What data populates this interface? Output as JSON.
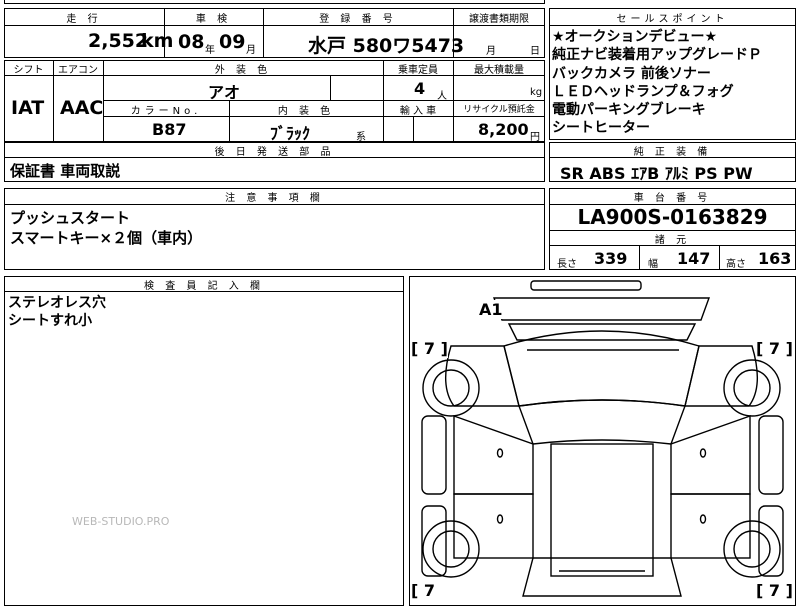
{
  "top_left": {
    "headers": {
      "mileage": "走 行",
      "inspection": "車 検",
      "registration": "登 録 番 号",
      "transfer_deadline": "譲渡書類期限"
    },
    "mileage": "2,552",
    "mileage_unit": "km",
    "inspection_year": "08",
    "inspection_year_unit": "年",
    "inspection_month": "09",
    "inspection_month_unit": "月",
    "registration": "水戸 580ワ5473",
    "transfer_month_unit": "月",
    "transfer_day_unit": "日",
    "row2_headers": {
      "shift": "シフト",
      "aircon": "エアコン",
      "exterior_color": "外 装 色",
      "capacity": "乗車定員",
      "max_load": "最大積載量"
    },
    "shift": "IAT",
    "aircon": "AAC",
    "exterior_color": "アオ",
    "capacity": "4",
    "capacity_unit": "人",
    "max_load_unit": "kg",
    "row3_headers": {
      "color_no": "カラーNo.",
      "interior_color": "内 装 色",
      "import": "輸 入 車",
      "recycle": "リサイクル預託金"
    },
    "color_no": "B87",
    "interior_color": "ﾌﾞﾗｯｸ",
    "interior_suffix": "系",
    "recycle": "8,200",
    "recycle_unit": "円",
    "later_parts_header": "後 日 発 送 部 品",
    "later_parts": "保証書 車両取説"
  },
  "selling_points": {
    "header": "セールスポイント",
    "lines": [
      "★オークションデビュー★",
      "純正ナビ装着用アップグレードＰ",
      "バックカメラ 前後ソナー",
      "ＬＥＤヘッドランプ＆フォグ",
      "電動パーキングブレーキ",
      "シートヒーター"
    ]
  },
  "genuine_equipment": {
    "header": "純 正 装 備",
    "value": "SR ABS ｴｱB ｱﾙﾐ PS PW"
  },
  "notes": {
    "header": "注 意 事 項 欄",
    "lines": [
      "プッシュスタート",
      "スマートキー×２個（車内）"
    ]
  },
  "chassis": {
    "header": "車 台 番 号",
    "value": "LA900S-0163829"
  },
  "specs": {
    "header": "諸 元",
    "length_label": "長さ",
    "length": "339",
    "width_label": "幅",
    "width": "147",
    "height_label": "高さ",
    "height": "163"
  },
  "inspector": {
    "header": "検 査 員 記 入 欄",
    "lines": [
      "ステレオレス穴",
      "シートすれ小"
    ]
  },
  "diagram": {
    "mark": "A1",
    "tire_left_top": "[ 7 ]",
    "tire_right_top": "[ 7 ]",
    "tire_left_bottom": "[ 7",
    "tire_right_bottom": "[ 7 ]"
  },
  "watermark": "WEB-STUDIO.PRO"
}
